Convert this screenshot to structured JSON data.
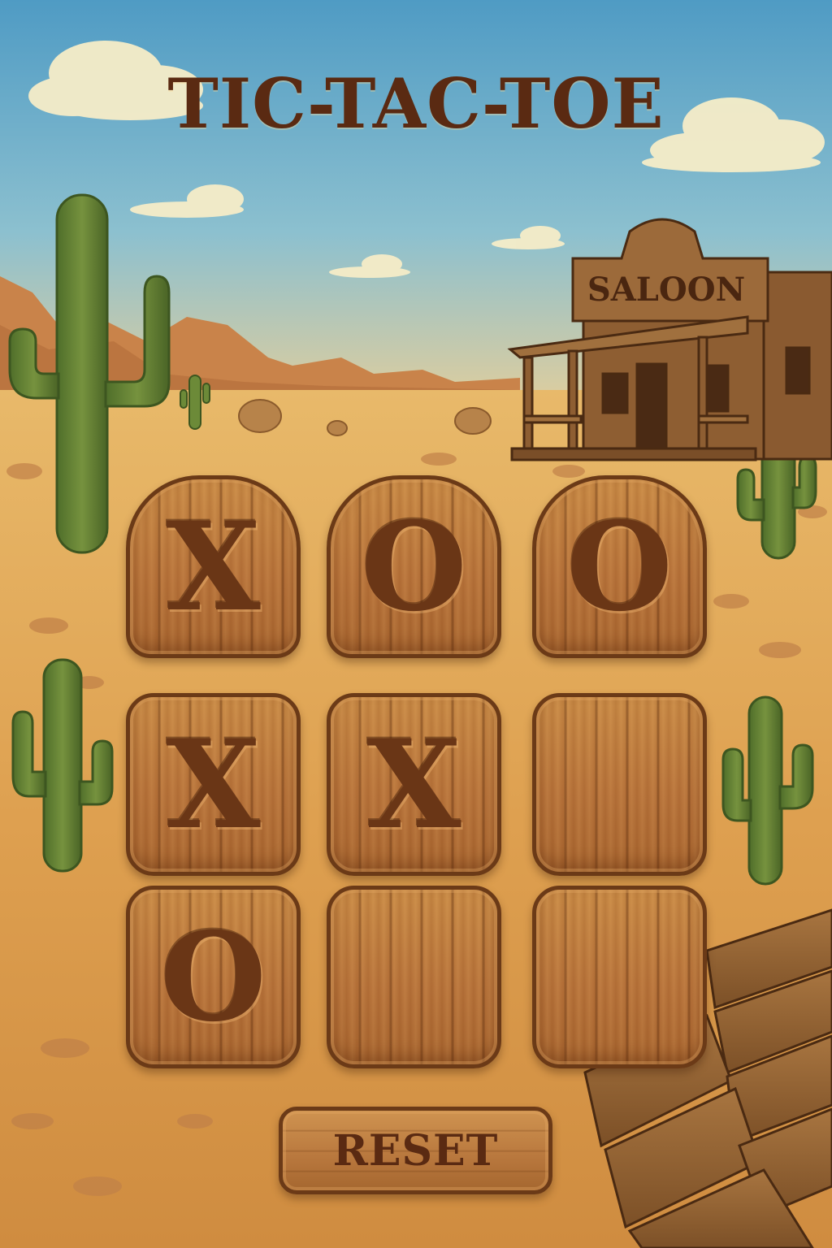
{
  "title": "TIC-TAC-TOE",
  "saloon_sign": "SALOON",
  "board": {
    "cells": [
      "X",
      "O",
      "O",
      "X",
      "X",
      "",
      "O",
      "",
      ""
    ]
  },
  "reset_label": "RESET",
  "colors": {
    "sky_top": "#5aa3c8",
    "sand": "#e0a655",
    "wood": "#b8733a",
    "ink": "#5a2a12"
  }
}
